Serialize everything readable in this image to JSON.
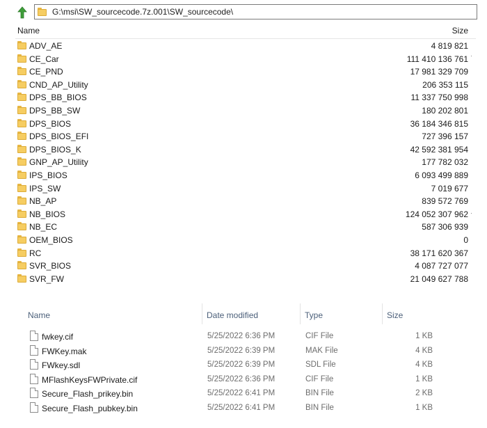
{
  "top_panel": {
    "path": "G:\\msi\\SW_sourcecode.7z.001\\SW_sourcecode\\",
    "columns": {
      "name": "Name",
      "size": "Size"
    },
    "folders": [
      {
        "name": "ADV_AE",
        "size": "4 819 821"
      },
      {
        "name": "CE_Car",
        "size": "111 410 136 761"
      },
      {
        "name": "CE_PND",
        "size": "17 981 329 709"
      },
      {
        "name": "CND_AP_Utility",
        "size": "206 353 115"
      },
      {
        "name": "DPS_BB_BIOS",
        "size": "11 337 750 998"
      },
      {
        "name": "DPS_BB_SW",
        "size": "180 202 801"
      },
      {
        "name": "DPS_BIOS",
        "size": "36 184 346 815"
      },
      {
        "name": "DPS_BIOS_EFI",
        "size": "727 396 157"
      },
      {
        "name": "DPS_BIOS_K",
        "size": "42 592 381 954"
      },
      {
        "name": "GNP_AP_Utility",
        "size": "177 782 032"
      },
      {
        "name": "IPS_BIOS",
        "size": "6 093 499 889"
      },
      {
        "name": "IPS_SW",
        "size": "7 019 677"
      },
      {
        "name": "NB_AP",
        "size": "839 572 769"
      },
      {
        "name": "NB_BIOS",
        "size": "124 052 307 962"
      },
      {
        "name": "NB_EC",
        "size": "587 306 939"
      },
      {
        "name": "OEM_BIOS",
        "size": "0"
      },
      {
        "name": "RC",
        "size": "38 171 620 367"
      },
      {
        "name": "SVR_BIOS",
        "size": "4 087 727 077"
      },
      {
        "name": "SVR_FW",
        "size": "21 049 627 788"
      }
    ]
  },
  "bottom_panel": {
    "columns": {
      "name": "Name",
      "date": "Date modified",
      "type": "Type",
      "size": "Size"
    },
    "files": [
      {
        "name": "fwkey.cif",
        "date": "5/25/2022 6:36 PM",
        "type": "CIF File",
        "size": "1 KB"
      },
      {
        "name": "FWKey.mak",
        "date": "5/25/2022 6:39 PM",
        "type": "MAK File",
        "size": "4 KB"
      },
      {
        "name": "FWkey.sdl",
        "date": "5/25/2022 6:39 PM",
        "type": "SDL File",
        "size": "4 KB"
      },
      {
        "name": "MFlashKeysFWPrivate.cif",
        "date": "5/25/2022 6:36 PM",
        "type": "CIF File",
        "size": "1 KB"
      },
      {
        "name": "Secure_Flash_prikey.bin",
        "date": "5/25/2022 6:41 PM",
        "type": "BIN File",
        "size": "2 KB"
      },
      {
        "name": "Secure_Flash_pubkey.bin",
        "date": "5/25/2022 6:41 PM",
        "type": "BIN File",
        "size": "1 KB"
      }
    ]
  },
  "colors": {
    "folder": "#f6cd62",
    "header_text": "#4c607a",
    "up_arrow": "#3f9e3a"
  }
}
